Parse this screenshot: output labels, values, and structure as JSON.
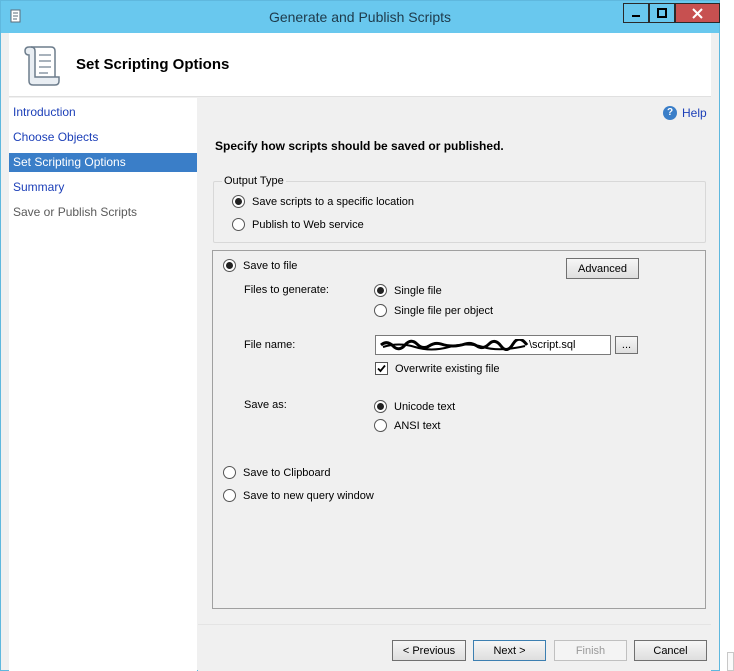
{
  "window": {
    "title": "Generate and Publish Scripts",
    "icon": "script-scroll-icon",
    "accent": "#69c8ee"
  },
  "header": {
    "title": "Set Scripting Options",
    "icon": "scroll-icon"
  },
  "sidebar": {
    "items": [
      {
        "label": "Introduction",
        "state": "link"
      },
      {
        "label": "Choose Objects",
        "state": "link"
      },
      {
        "label": "Set Scripting Options",
        "state": "active"
      },
      {
        "label": "Summary",
        "state": "link"
      },
      {
        "label": "Save or Publish Scripts",
        "state": "disabled"
      }
    ],
    "active_color": "#3a7ec8"
  },
  "main": {
    "help_label": "Help",
    "instruction": "Specify how scripts should be saved or published.",
    "output_type": {
      "legend": "Output Type",
      "options": [
        {
          "label": "Save scripts to a specific location",
          "checked": true
        },
        {
          "label": "Publish to Web service",
          "checked": false
        }
      ]
    },
    "save_panel": {
      "save_to_file_label": "Save to file",
      "advanced_label": "Advanced",
      "files_to_generate_label": "Files to generate:",
      "file_options": [
        {
          "label": "Single file",
          "checked": true
        },
        {
          "label": "Single file per object",
          "checked": false
        }
      ],
      "file_name_label": "File name:",
      "file_name_value": "\\script.sql",
      "browse_label": "...",
      "overwrite_label": "Overwrite existing file",
      "overwrite_checked": true,
      "save_as_label": "Save as:",
      "encoding_options": [
        {
          "label": "Unicode text",
          "checked": true
        },
        {
          "label": "ANSI text",
          "checked": false
        }
      ],
      "clipboard_label": "Save to Clipboard",
      "query_window_label": "Save to new query window"
    }
  },
  "footer": {
    "previous_label": "< Previous",
    "next_label": "Next >",
    "finish_label": "Finish",
    "cancel_label": "Cancel"
  }
}
